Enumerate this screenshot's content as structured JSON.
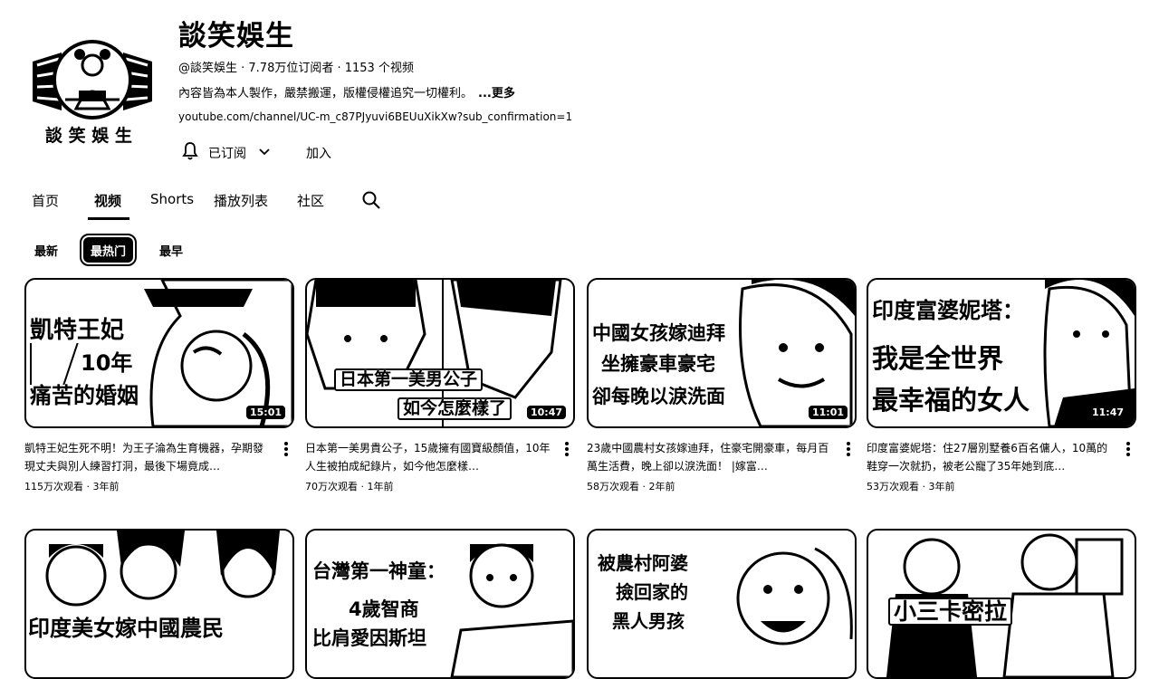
{
  "channel": {
    "name": "談笑娛生",
    "avatar_text": "談 笑 娛 生",
    "meta": "@談笑娛生 · 7.78万位订阅者 · 1153 个视频",
    "description": "內容皆為本人製作，嚴禁搬運，版權侵權追究一切權利。",
    "description_more": "...更多",
    "link": "youtube.com/channel/UC-m_c87PJyuvi6BEUuXikXw?sub_confirmation=1",
    "subscribed_label": "已订阅",
    "join_label": "加入"
  },
  "tabs": {
    "home": "首页",
    "videos": "视频",
    "shorts": "Shorts",
    "playlists": "播放列表",
    "community": "社区"
  },
  "sort": {
    "latest": "最新",
    "popular": "最热门",
    "oldest": "最早"
  },
  "videos": [
    {
      "overlay": [
        "凱特王妃",
        "10年",
        "痛苦的婚姻"
      ],
      "duration": "15:01",
      "title": "凱特王妃生死不明！为王子淪為生育機器，孕期發現丈夫與別人練習打洞，最後下場竟成…",
      "meta": "115万次观看 · 3年前"
    },
    {
      "overlay": [
        "日本第一美男公子",
        "如今怎麼樣了"
      ],
      "duration": "10:47",
      "title": "日本第一美男貴公子，15歲擁有國寶級顏值，10年人生被拍成紀錄片，如今他怎麼樣…",
      "meta": "70万次观看 · 1年前"
    },
    {
      "overlay": [
        "中國女孩嫁迪拜",
        "坐擁豪車豪宅",
        "卻每晚以淚洗面"
      ],
      "duration": "11:01",
      "title": "23歲中國農村女孩嫁迪拜，住豪宅開豪車，每月百萬生活費，晚上卻以淚洗面！ |嫁富…",
      "meta": "58万次观看 · 2年前"
    },
    {
      "overlay": [
        "印度富婆妮塔：",
        "我是全世界",
        "最幸福的女人"
      ],
      "duration": "11:47",
      "title": "印度富婆妮塔：住27層別墅養6百名傭人，10萬的鞋穿一次就扔，被老公寵了35年她到底…",
      "meta": "53万次观看 · 3年前"
    },
    {
      "overlay": [
        "印度美女嫁中國農民"
      ],
      "duration": "",
      "title": "",
      "meta": ""
    },
    {
      "overlay": [
        "台灣第一神童：",
        "4歲智商",
        "比肩愛因斯坦"
      ],
      "duration": "",
      "title": "",
      "meta": ""
    },
    {
      "overlay": [
        "被農村阿婆",
        "撿回家的",
        "黑人男孩"
      ],
      "duration": "",
      "title": "",
      "meta": ""
    },
    {
      "overlay": [
        "小三卡密拉"
      ],
      "duration": "",
      "title": "",
      "meta": ""
    }
  ]
}
